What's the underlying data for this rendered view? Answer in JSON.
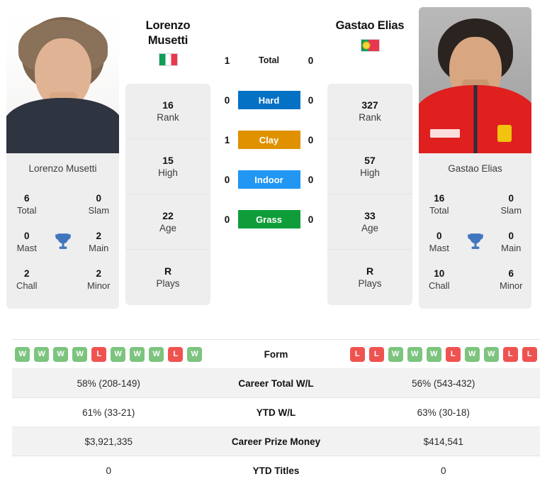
{
  "players": {
    "left": {
      "full_name": "Lorenzo Musetti",
      "name_line1": "Lorenzo",
      "name_line2": "Musetti",
      "country_flag": "italy-flag",
      "photo_label": "lorenzo-musetti-photo",
      "card_name": "Lorenzo Musetti",
      "titles": {
        "total_value": "6",
        "total_label": "Total",
        "slam_value": "0",
        "slam_label": "Slam",
        "mast_value": "0",
        "mast_label": "Mast",
        "main_value": "2",
        "main_label": "Main",
        "chall_value": "2",
        "chall_label": "Chall",
        "minor_value": "2",
        "minor_label": "Minor",
        "trophy_icon": "trophy-icon"
      },
      "stack": [
        {
          "value": "16",
          "label": "Rank"
        },
        {
          "value": "15",
          "label": "High"
        },
        {
          "value": "22",
          "label": "Age"
        },
        {
          "value": "R",
          "label": "Plays"
        }
      ],
      "form": [
        "W",
        "W",
        "W",
        "W",
        "L",
        "W",
        "W",
        "W",
        "L",
        "W"
      ],
      "career_total_wl": "58% (208-149)",
      "ytd_wl": "61% (33-21)",
      "career_prize_money": "$3,921,335",
      "ytd_titles": "0"
    },
    "right": {
      "full_name": "Gastao Elias",
      "name_line1": "Gastao Elias",
      "name_line2": "",
      "country_flag": "portugal-flag",
      "photo_label": "gastao-elias-photo",
      "card_name": "Gastao Elias",
      "titles": {
        "total_value": "16",
        "total_label": "Total",
        "slam_value": "0",
        "slam_label": "Slam",
        "mast_value": "0",
        "mast_label": "Mast",
        "main_value": "0",
        "main_label": "Main",
        "chall_value": "10",
        "chall_label": "Chall",
        "minor_value": "6",
        "minor_label": "Minor",
        "trophy_icon": "trophy-icon"
      },
      "stack": [
        {
          "value": "327",
          "label": "Rank"
        },
        {
          "value": "57",
          "label": "High"
        },
        {
          "value": "33",
          "label": "Age"
        },
        {
          "value": "R",
          "label": "Plays"
        }
      ],
      "form": [
        "L",
        "L",
        "W",
        "W",
        "W",
        "L",
        "W",
        "W",
        "L",
        "L"
      ],
      "career_total_wl": "56% (543-432)",
      "ytd_wl": "63% (30-18)",
      "career_prize_money": "$414,541",
      "ytd_titles": "0"
    }
  },
  "head_to_head": [
    {
      "label": "Total",
      "left": "1",
      "right": "0",
      "kind": "total",
      "color": ""
    },
    {
      "label": "Hard",
      "left": "0",
      "right": "0",
      "kind": "surface",
      "color": "#0571c4"
    },
    {
      "label": "Clay",
      "left": "1",
      "right": "0",
      "kind": "surface",
      "color": "#e09100"
    },
    {
      "label": "Indoor",
      "left": "0",
      "right": "0",
      "kind": "surface",
      "color": "#2196f3"
    },
    {
      "label": "Grass",
      "left": "0",
      "right": "0",
      "kind": "surface",
      "color": "#0f9d3a"
    }
  ],
  "stats_rows": [
    {
      "label": "Form",
      "kind": "form"
    },
    {
      "label": "Career Total W/L",
      "kind": "text",
      "left_key": "career_total_wl",
      "right_key": "career_total_wl"
    },
    {
      "label": "YTD W/L",
      "kind": "text",
      "left_key": "ytd_wl",
      "right_key": "ytd_wl"
    },
    {
      "label": "Career Prize Money",
      "kind": "text",
      "left_key": "career_prize_money",
      "right_key": "career_prize_money"
    },
    {
      "label": "YTD Titles",
      "kind": "text",
      "left_key": "ytd_titles",
      "right_key": "ytd_titles"
    }
  ],
  "colors": {
    "hard": "#0571c4",
    "clay": "#e09100",
    "indoor": "#2196f3",
    "grass": "#0f9d3a",
    "win": "#7dc47f",
    "loss": "#ef5350",
    "trophy": "#3f76bd",
    "card_bg": "#eeeeee"
  }
}
